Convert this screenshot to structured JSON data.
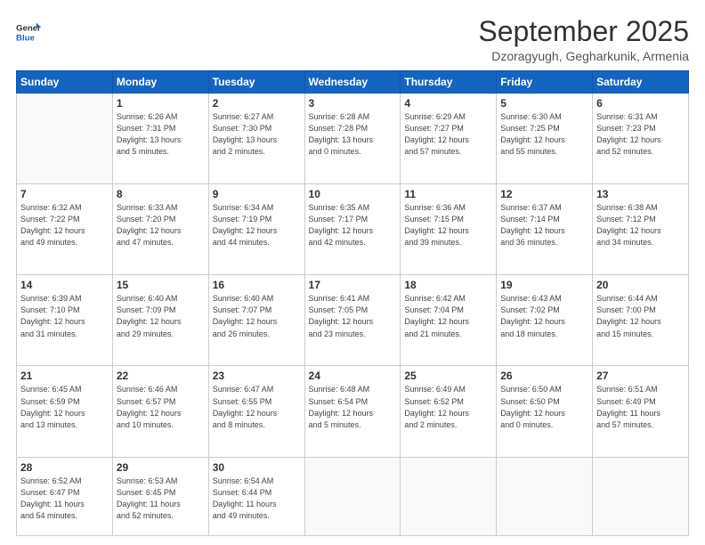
{
  "logo": {
    "line1": "General",
    "line2": "Blue"
  },
  "title": "September 2025",
  "subtitle": "Dzoragyugh, Gegharkunik, Armenia",
  "weekdays": [
    "Sunday",
    "Monday",
    "Tuesday",
    "Wednesday",
    "Thursday",
    "Friday",
    "Saturday"
  ],
  "weeks": [
    [
      {
        "day": "",
        "info": ""
      },
      {
        "day": "1",
        "info": "Sunrise: 6:26 AM\nSunset: 7:31 PM\nDaylight: 13 hours\nand 5 minutes."
      },
      {
        "day": "2",
        "info": "Sunrise: 6:27 AM\nSunset: 7:30 PM\nDaylight: 13 hours\nand 2 minutes."
      },
      {
        "day": "3",
        "info": "Sunrise: 6:28 AM\nSunset: 7:28 PM\nDaylight: 13 hours\nand 0 minutes."
      },
      {
        "day": "4",
        "info": "Sunrise: 6:29 AM\nSunset: 7:27 PM\nDaylight: 12 hours\nand 57 minutes."
      },
      {
        "day": "5",
        "info": "Sunrise: 6:30 AM\nSunset: 7:25 PM\nDaylight: 12 hours\nand 55 minutes."
      },
      {
        "day": "6",
        "info": "Sunrise: 6:31 AM\nSunset: 7:23 PM\nDaylight: 12 hours\nand 52 minutes."
      }
    ],
    [
      {
        "day": "7",
        "info": "Sunrise: 6:32 AM\nSunset: 7:22 PM\nDaylight: 12 hours\nand 49 minutes."
      },
      {
        "day": "8",
        "info": "Sunrise: 6:33 AM\nSunset: 7:20 PM\nDaylight: 12 hours\nand 47 minutes."
      },
      {
        "day": "9",
        "info": "Sunrise: 6:34 AM\nSunset: 7:19 PM\nDaylight: 12 hours\nand 44 minutes."
      },
      {
        "day": "10",
        "info": "Sunrise: 6:35 AM\nSunset: 7:17 PM\nDaylight: 12 hours\nand 42 minutes."
      },
      {
        "day": "11",
        "info": "Sunrise: 6:36 AM\nSunset: 7:15 PM\nDaylight: 12 hours\nand 39 minutes."
      },
      {
        "day": "12",
        "info": "Sunrise: 6:37 AM\nSunset: 7:14 PM\nDaylight: 12 hours\nand 36 minutes."
      },
      {
        "day": "13",
        "info": "Sunrise: 6:38 AM\nSunset: 7:12 PM\nDaylight: 12 hours\nand 34 minutes."
      }
    ],
    [
      {
        "day": "14",
        "info": "Sunrise: 6:39 AM\nSunset: 7:10 PM\nDaylight: 12 hours\nand 31 minutes."
      },
      {
        "day": "15",
        "info": "Sunrise: 6:40 AM\nSunset: 7:09 PM\nDaylight: 12 hours\nand 29 minutes."
      },
      {
        "day": "16",
        "info": "Sunrise: 6:40 AM\nSunset: 7:07 PM\nDaylight: 12 hours\nand 26 minutes."
      },
      {
        "day": "17",
        "info": "Sunrise: 6:41 AM\nSunset: 7:05 PM\nDaylight: 12 hours\nand 23 minutes."
      },
      {
        "day": "18",
        "info": "Sunrise: 6:42 AM\nSunset: 7:04 PM\nDaylight: 12 hours\nand 21 minutes."
      },
      {
        "day": "19",
        "info": "Sunrise: 6:43 AM\nSunset: 7:02 PM\nDaylight: 12 hours\nand 18 minutes."
      },
      {
        "day": "20",
        "info": "Sunrise: 6:44 AM\nSunset: 7:00 PM\nDaylight: 12 hours\nand 15 minutes."
      }
    ],
    [
      {
        "day": "21",
        "info": "Sunrise: 6:45 AM\nSunset: 6:59 PM\nDaylight: 12 hours\nand 13 minutes."
      },
      {
        "day": "22",
        "info": "Sunrise: 6:46 AM\nSunset: 6:57 PM\nDaylight: 12 hours\nand 10 minutes."
      },
      {
        "day": "23",
        "info": "Sunrise: 6:47 AM\nSunset: 6:55 PM\nDaylight: 12 hours\nand 8 minutes."
      },
      {
        "day": "24",
        "info": "Sunrise: 6:48 AM\nSunset: 6:54 PM\nDaylight: 12 hours\nand 5 minutes."
      },
      {
        "day": "25",
        "info": "Sunrise: 6:49 AM\nSunset: 6:52 PM\nDaylight: 12 hours\nand 2 minutes."
      },
      {
        "day": "26",
        "info": "Sunrise: 6:50 AM\nSunset: 6:50 PM\nDaylight: 12 hours\nand 0 minutes."
      },
      {
        "day": "27",
        "info": "Sunrise: 6:51 AM\nSunset: 6:49 PM\nDaylight: 11 hours\nand 57 minutes."
      }
    ],
    [
      {
        "day": "28",
        "info": "Sunrise: 6:52 AM\nSunset: 6:47 PM\nDaylight: 11 hours\nand 54 minutes."
      },
      {
        "day": "29",
        "info": "Sunrise: 6:53 AM\nSunset: 6:45 PM\nDaylight: 11 hours\nand 52 minutes."
      },
      {
        "day": "30",
        "info": "Sunrise: 6:54 AM\nSunset: 6:44 PM\nDaylight: 11 hours\nand 49 minutes."
      },
      {
        "day": "",
        "info": ""
      },
      {
        "day": "",
        "info": ""
      },
      {
        "day": "",
        "info": ""
      },
      {
        "day": "",
        "info": ""
      }
    ]
  ]
}
